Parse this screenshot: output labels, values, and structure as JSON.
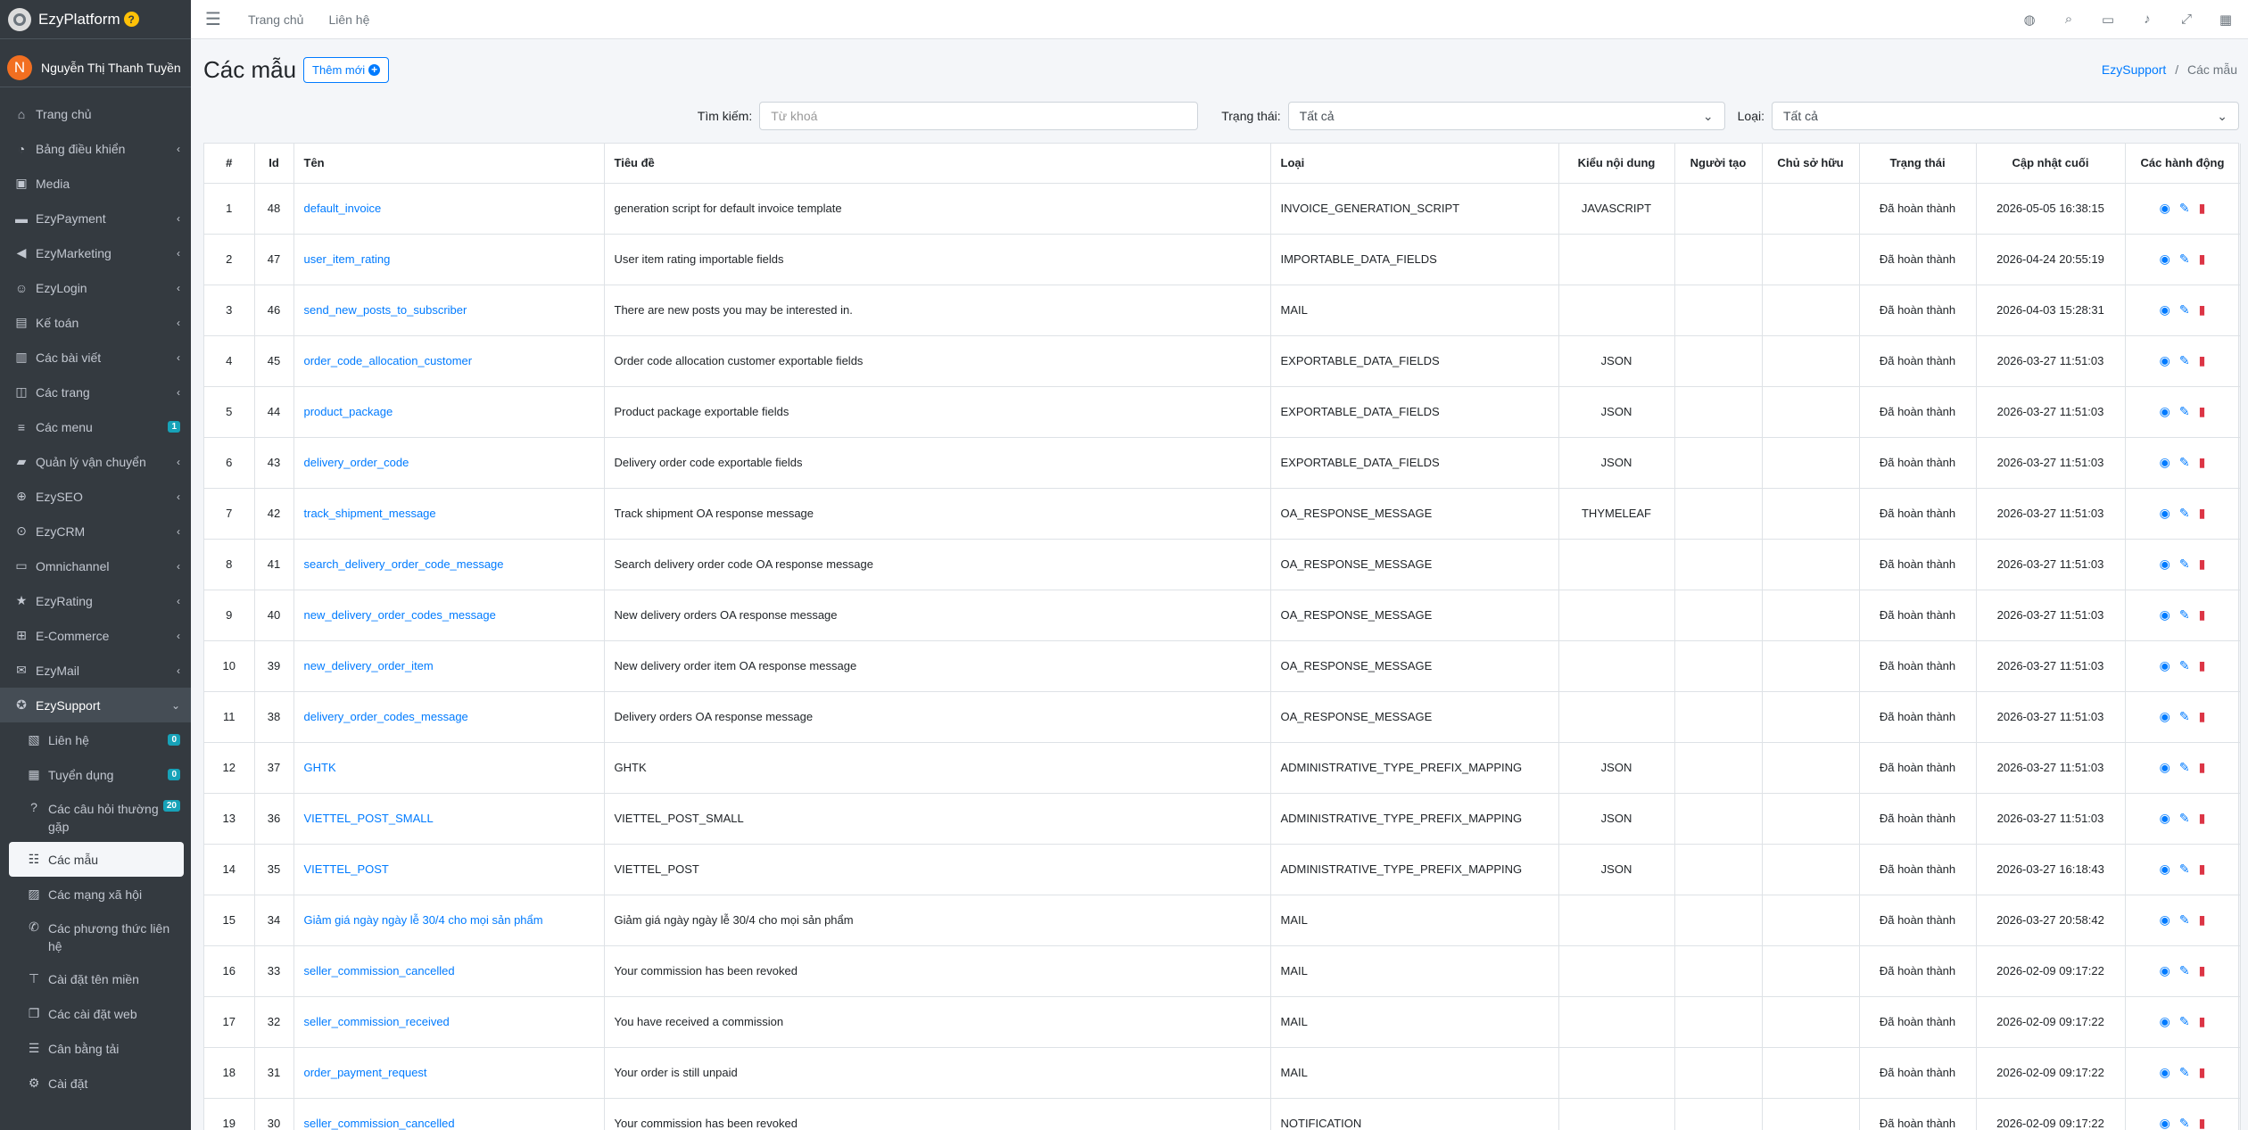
{
  "brand": {
    "name": "EzyPlatform",
    "badge": "?"
  },
  "user": {
    "initial": "N",
    "name": "Nguyễn Thị Thanh Tuyền"
  },
  "sidebar": {
    "items": [
      {
        "label": "Trang chủ",
        "icon": "home-icon",
        "arrow": false
      },
      {
        "label": "Bảng điều khiển",
        "icon": "dashboard-icon",
        "arrow": true
      },
      {
        "label": "Media",
        "icon": "image-icon",
        "arrow": false
      },
      {
        "label": "EzyPayment",
        "icon": "payment-icon",
        "arrow": true
      },
      {
        "label": "EzyMarketing",
        "icon": "megaphone-icon",
        "arrow": true
      },
      {
        "label": "EzyLogin",
        "icon": "user-lock-icon",
        "arrow": true
      },
      {
        "label": "Kế toán",
        "icon": "calculator-icon",
        "arrow": true
      },
      {
        "label": "Các bài viết",
        "icon": "book-icon",
        "arrow": true
      },
      {
        "label": "Các trang",
        "icon": "columns-icon",
        "arrow": true
      },
      {
        "label": "Các menu",
        "icon": "menu-icon",
        "count": "1"
      },
      {
        "label": "Quản lý vận chuyển",
        "icon": "truck-icon",
        "arrow": true
      },
      {
        "label": "EzySEO",
        "icon": "search-plus-icon",
        "arrow": true
      },
      {
        "label": "EzyCRM",
        "icon": "search-icon",
        "arrow": true
      },
      {
        "label": "Omnichannel",
        "icon": "folder-icon",
        "arrow": true
      },
      {
        "label": "EzyRating",
        "icon": "star-icon",
        "arrow": true
      },
      {
        "label": "E-Commerce",
        "icon": "cart-icon",
        "arrow": true
      },
      {
        "label": "EzyMail",
        "icon": "mail-icon",
        "arrow": true
      }
    ],
    "open": {
      "label": "EzySupport",
      "icon": "life-ring-icon"
    },
    "sub": [
      {
        "label": "Liên hệ",
        "icon": "contact-icon",
        "count": "0"
      },
      {
        "label": "Tuyển dụng",
        "icon": "grid-icon",
        "count": "0"
      },
      {
        "label": "Các câu hỏi thường gặp",
        "icon": "question-icon",
        "count": "20",
        "two": true
      },
      {
        "label": "Các mẫu",
        "icon": "list-icon",
        "active": true
      },
      {
        "label": "Các mạng xã hội",
        "icon": "share-icon"
      },
      {
        "label": "Các phương thức liên hệ",
        "icon": "phone-icon",
        "two": true
      },
      {
        "label": "Cài đặt tên miền",
        "icon": "sitemap-icon"
      },
      {
        "label": "Các cài đặt web",
        "icon": "window-icon"
      },
      {
        "label": "Cân bằng tải",
        "icon": "server-icon"
      },
      {
        "label": "Cài đặt",
        "icon": "cogs-icon"
      }
    ]
  },
  "topbar": {
    "home": "Trang chủ",
    "contact": "Liên hệ"
  },
  "header": {
    "title": "Các mẫu",
    "add": "Thêm mới",
    "crumb_root": "EzySupport",
    "crumb_sep": "/",
    "crumb_current": "Các mẫu"
  },
  "filters": {
    "search_label": "Tìm kiếm:",
    "search_placeholder": "Từ khoá",
    "status_label": "Trạng thái:",
    "status_value": "Tất cả",
    "type_label": "Loại:",
    "type_value": "Tất cả"
  },
  "table": {
    "headers": [
      "#",
      "Id",
      "Tên",
      "Tiêu đề",
      "Loại",
      "Kiểu nội dung",
      "Người tạo",
      "Chủ sở hữu",
      "Trạng thái",
      "Cập nhật cuối",
      "Các hành động"
    ],
    "rows": [
      [
        "1",
        "48",
        "default_invoice",
        "generation script for default invoice template",
        "INVOICE_GENERATION_SCRIPT",
        "JAVASCRIPT",
        "",
        "",
        "Đã hoàn thành",
        "2026-05-05 16:38:15"
      ],
      [
        "2",
        "47",
        "user_item_rating",
        "User item rating importable fields",
        "IMPORTABLE_DATA_FIELDS",
        "",
        "",
        "",
        "Đã hoàn thành",
        "2026-04-24 20:55:19"
      ],
      [
        "3",
        "46",
        "send_new_posts_to_subscriber",
        "There are new posts you may be interested in.",
        "MAIL",
        "",
        "",
        "",
        "Đã hoàn thành",
        "2026-04-03 15:28:31"
      ],
      [
        "4",
        "45",
        "order_code_allocation_customer",
        "Order code allocation customer exportable fields",
        "EXPORTABLE_DATA_FIELDS",
        "JSON",
        "",
        "",
        "Đã hoàn thành",
        "2026-03-27 11:51:03"
      ],
      [
        "5",
        "44",
        "product_package",
        "Product package exportable fields",
        "EXPORTABLE_DATA_FIELDS",
        "JSON",
        "",
        "",
        "Đã hoàn thành",
        "2026-03-27 11:51:03"
      ],
      [
        "6",
        "43",
        "delivery_order_code",
        "Delivery order code exportable fields",
        "EXPORTABLE_DATA_FIELDS",
        "JSON",
        "",
        "",
        "Đã hoàn thành",
        "2026-03-27 11:51:03"
      ],
      [
        "7",
        "42",
        "track_shipment_message",
        "Track shipment OA response message",
        "OA_RESPONSE_MESSAGE",
        "THYMELEAF",
        "",
        "",
        "Đã hoàn thành",
        "2026-03-27 11:51:03"
      ],
      [
        "8",
        "41",
        "search_delivery_order_code_message",
        "Search delivery order code OA response message",
        "OA_RESPONSE_MESSAGE",
        "",
        "",
        "",
        "Đã hoàn thành",
        "2026-03-27 11:51:03"
      ],
      [
        "9",
        "40",
        "new_delivery_order_codes_message",
        "New delivery orders OA response message",
        "OA_RESPONSE_MESSAGE",
        "",
        "",
        "",
        "Đã hoàn thành",
        "2026-03-27 11:51:03"
      ],
      [
        "10",
        "39",
        "new_delivery_order_item",
        "New delivery order item OA response message",
        "OA_RESPONSE_MESSAGE",
        "",
        "",
        "",
        "Đã hoàn thành",
        "2026-03-27 11:51:03"
      ],
      [
        "11",
        "38",
        "delivery_order_codes_message",
        "Delivery orders OA response message",
        "OA_RESPONSE_MESSAGE",
        "",
        "",
        "",
        "Đã hoàn thành",
        "2026-03-27 11:51:03"
      ],
      [
        "12",
        "37",
        "GHTK",
        "GHTK",
        "ADMINISTRATIVE_TYPE_PREFIX_MAPPING",
        "JSON",
        "",
        "",
        "Đã hoàn thành",
        "2026-03-27 11:51:03"
      ],
      [
        "13",
        "36",
        "VIETTEL_POST_SMALL",
        "VIETTEL_POST_SMALL",
        "ADMINISTRATIVE_TYPE_PREFIX_MAPPING",
        "JSON",
        "",
        "",
        "Đã hoàn thành",
        "2026-03-27 11:51:03"
      ],
      [
        "14",
        "35",
        "VIETTEL_POST",
        "VIETTEL_POST",
        "ADMINISTRATIVE_TYPE_PREFIX_MAPPING",
        "JSON",
        "",
        "",
        "Đã hoàn thành",
        "2026-03-27 16:18:43"
      ],
      [
        "15",
        "34",
        "Giảm giá ngày ngày lễ 30/4 cho mọi sản phẩm",
        "Giảm giá ngày ngày lễ 30/4 cho mọi sản phẩm",
        "MAIL",
        "",
        "",
        "",
        "Đã hoàn thành",
        "2026-03-27 20:58:42"
      ],
      [
        "16",
        "33",
        "seller_commission_cancelled",
        "Your commission has been revoked",
        "MAIL",
        "",
        "",
        "",
        "Đã hoàn thành",
        "2026-02-09 09:17:22"
      ],
      [
        "17",
        "32",
        "seller_commission_received",
        "You have received a commission",
        "MAIL",
        "",
        "",
        "",
        "Đã hoàn thành",
        "2026-02-09 09:17:22"
      ],
      [
        "18",
        "31",
        "order_payment_request",
        "Your order is still unpaid",
        "MAIL",
        "",
        "",
        "",
        "Đã hoàn thành",
        "2026-02-09 09:17:22"
      ],
      [
        "19",
        "30",
        "seller_commission_cancelled",
        "Your commission has been revoked",
        "NOTIFICATION",
        "",
        "",
        "",
        "Đã hoàn thành",
        "2026-02-09 09:17:22"
      ]
    ]
  },
  "colors": {
    "sidebar": "#343a40",
    "accent": "#007bff",
    "danger": "#dc3545",
    "badge": "#17a2b8"
  }
}
